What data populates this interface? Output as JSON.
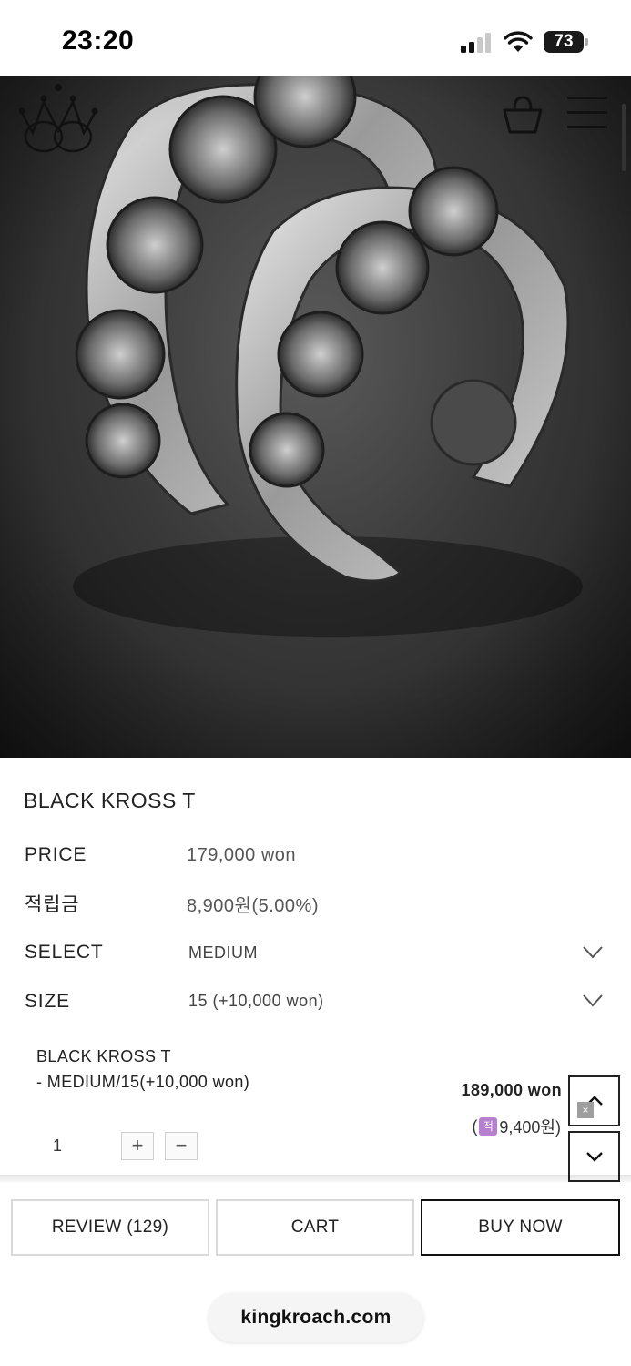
{
  "status_bar": {
    "time": "23:20",
    "battery": "73",
    "icons": [
      "signal-icon",
      "wifi-icon",
      "battery-icon"
    ]
  },
  "header": {
    "logo": "crown-logo",
    "cart_icon": "shopping-basket-icon",
    "menu_icon": "hamburger-menu-icon"
  },
  "product": {
    "title": "BLACK KROSS T",
    "price_label": "PRICE",
    "price_value": "179,000 won",
    "points_label": "적립금",
    "points_value": "8,900원(5.00%)"
  },
  "options": {
    "select_label": "SELECT",
    "select_value": "MEDIUM",
    "size_label": "SIZE",
    "size_value": "15 (+10,000 won)"
  },
  "selected_item": {
    "name": "BLACK KROSS T",
    "detail": "- MEDIUM/15(+10,000 won)",
    "quantity": "1",
    "plus": "+",
    "minus": "−",
    "total_price": "189,000 won",
    "points_open": "(",
    "points_badge": "적",
    "points_amount": "9,400원)"
  },
  "side_nav": {
    "up_icon": "chevron-up-icon",
    "down_icon": "chevron-down-icon",
    "ad_close": "×"
  },
  "actions": {
    "review": "REVIEW (129)",
    "cart": "CART",
    "buy": "BUY NOW"
  },
  "browser": {
    "url": "kingkroach.com"
  }
}
